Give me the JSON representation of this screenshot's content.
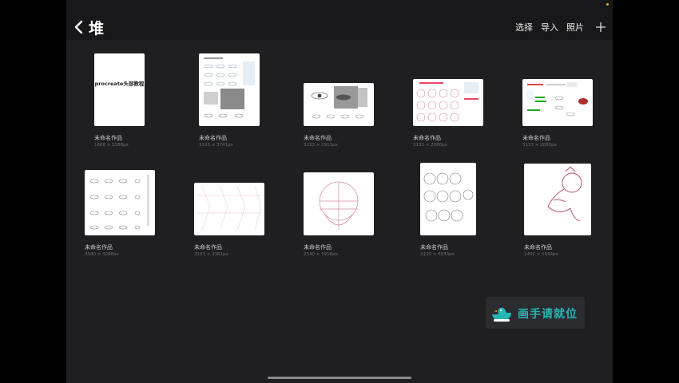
{
  "header": {
    "title": "堆",
    "actions": {
      "select": "选择",
      "import": "导入",
      "photos": "照片"
    }
  },
  "artworks": [
    {
      "name": "未命名作品",
      "dims": "1668 × 2388px",
      "cover": "procreate头部教程"
    },
    {
      "name": "未命名作品",
      "dims": "3133 × 3741px"
    },
    {
      "name": "未命名作品",
      "dims": "3133 × 1911px"
    },
    {
      "name": "未命名作品",
      "dims": "3133 × 2080px"
    },
    {
      "name": "未命名作品",
      "dims": "3133 × 2080px"
    },
    {
      "name": "未命名作品",
      "dims": "3540 × 3298px"
    },
    {
      "name": "未命名作品",
      "dims": "3133 × 2361px"
    },
    {
      "name": "未命名作品",
      "dims": "2140 × 1916px"
    },
    {
      "name": "未命名作品",
      "dims": "3133 × 6033px"
    },
    {
      "name": "未命名作品",
      "dims": "1492 × 1594px"
    }
  ],
  "watermark": {
    "text": "画手请就位",
    "icon": "duck-logo-icon"
  },
  "colors": {
    "accent": "#27b5b5",
    "sketch": "#d88aa0",
    "status_dot": "#e6b000"
  }
}
